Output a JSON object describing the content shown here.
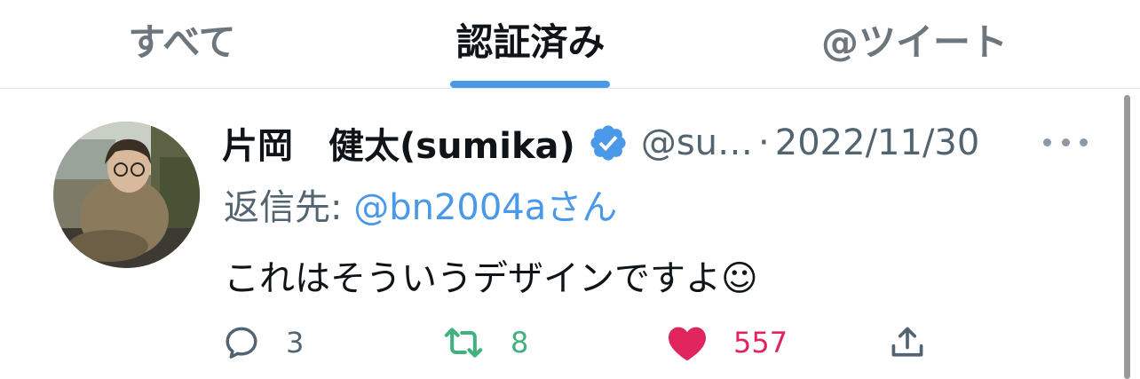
{
  "tabs": [
    {
      "label": "すべて",
      "active": false
    },
    {
      "label": "認証済み",
      "active": true
    },
    {
      "label": "@ツイート",
      "active": false
    }
  ],
  "tweet": {
    "display_name": "片岡　健太(sumika)",
    "handle": "@su…",
    "separator": "·",
    "timestamp": "2022/11/30",
    "reply_prefix": "返信先: ",
    "reply_handle": "@bn2004a",
    "reply_suffix": "さん",
    "text": "これはそういうデザインですよ☺",
    "counts": {
      "reply": "3",
      "retweet": "8",
      "like": "557"
    }
  },
  "icons": {
    "verified": "verified-badge-icon",
    "more": "more-icon",
    "reply": "reply-icon",
    "retweet": "retweet-icon",
    "like": "heart-icon",
    "share": "share-icon"
  },
  "colors": {
    "accent": "#4a99e9",
    "retweet": "#3fb27f",
    "like": "#e0245e",
    "muted": "#536471"
  }
}
